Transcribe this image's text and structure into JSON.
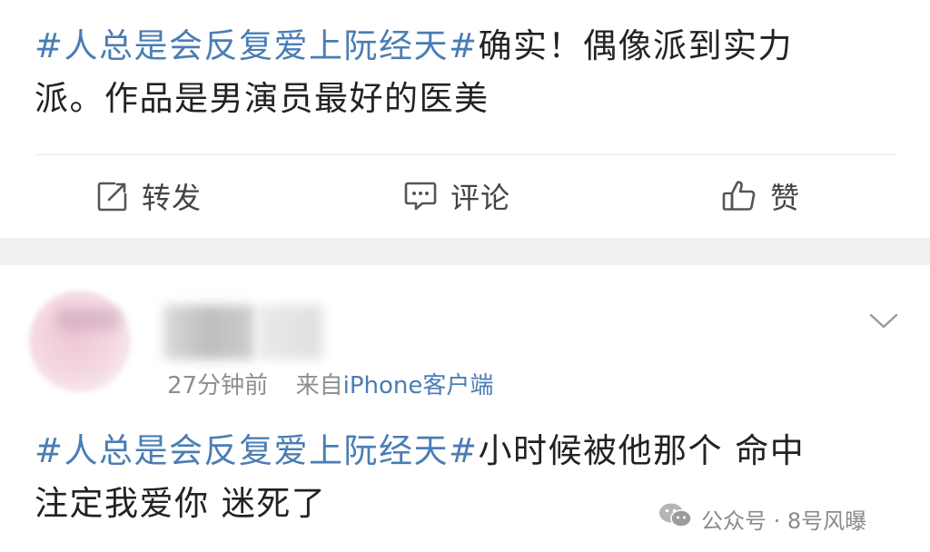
{
  "post1": {
    "topic": "#人总是会反复爱上阮经天#",
    "line1_rest": "确实！偶像派到实力",
    "line2": "派。作品是男演员最好的医美"
  },
  "actions": {
    "repost": "转发",
    "comment": "评论",
    "like": "赞"
  },
  "post2": {
    "time": "27分钟前",
    "source_prefix": "来自",
    "device": "iPhone客户端",
    "topic": "#人总是会反复爱上阮经天#",
    "line1_rest": "小时候被他那个 命中",
    "line2": "注定我爱你 迷死了"
  },
  "watermark": {
    "text": "公众号 · 8号风曝"
  },
  "colors": {
    "topic": "#4a7db4",
    "text": "#222222",
    "meta": "#8e8e8e",
    "separator": "#f0f0f0"
  },
  "icons": {
    "repost": "share-edit-icon",
    "comment": "comment-bubble-icon",
    "like": "thumbs-up-icon",
    "more": "chevron-down-icon",
    "watermark": "wechat-icon"
  }
}
